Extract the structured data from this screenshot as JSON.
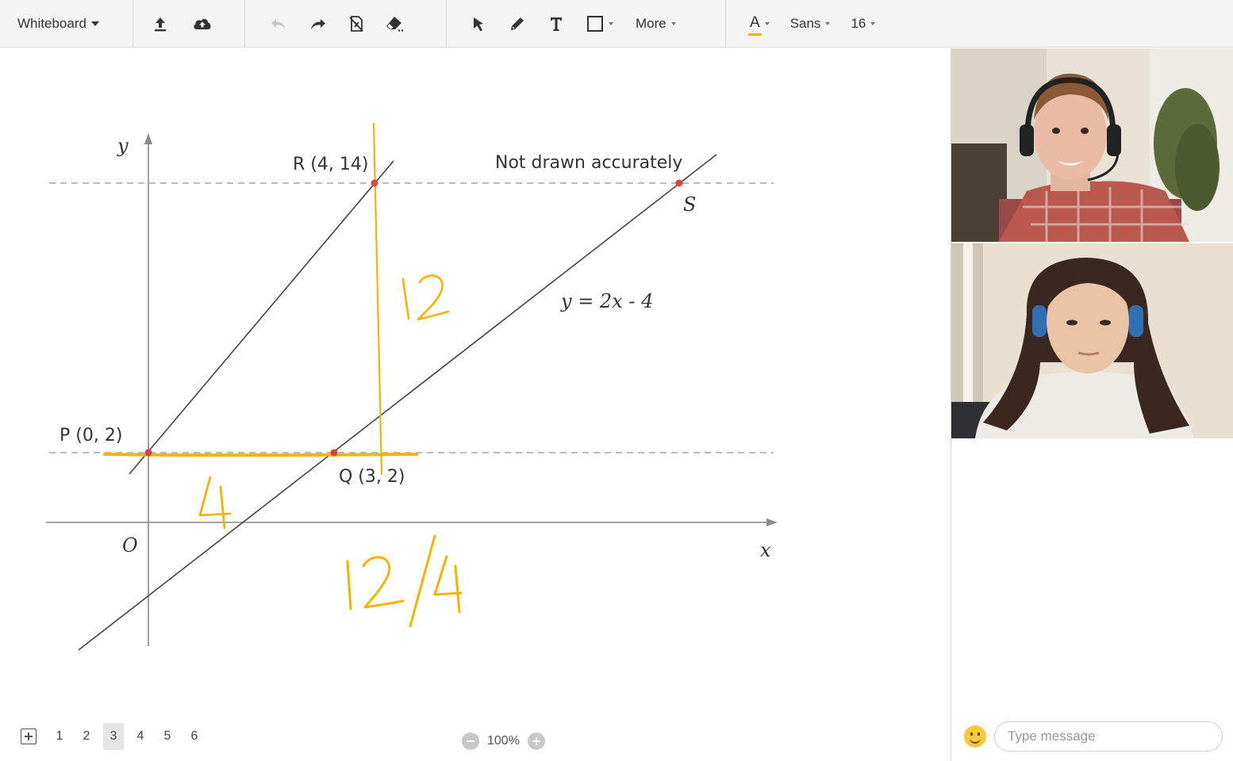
{
  "toolbar": {
    "board_menu_label": "Whiteboard",
    "icons": [
      "upload-icon",
      "cloud-icon",
      "undo-icon",
      "redo-icon",
      "clear-page-icon",
      "eraser-icon",
      "select-icon",
      "pen-icon",
      "text-icon",
      "shape-icon"
    ],
    "more_label": "More",
    "text_color_label": "A",
    "font_label": "Sans",
    "font_size_label": "16",
    "accent_color": "#f5b400"
  },
  "board": {
    "axis_y_label": "y",
    "axis_x_label": "x",
    "origin_label": "O",
    "point_r_label": "R (4, 14)",
    "point_p_label": "P (0, 2)",
    "point_q_label": "Q (3, 2)",
    "point_s_label": "S",
    "note_label": "Not drawn accurately",
    "equation_label": "y = 2x - 4",
    "handwriting": {
      "vertical_length": "12",
      "horizontal_length": "4",
      "gradient": "12/4"
    },
    "ink_color": "#f5b400",
    "point_color": "#d9473a"
  },
  "pages": {
    "items": [
      "1",
      "2",
      "3",
      "4",
      "5",
      "6"
    ],
    "active": "3"
  },
  "zoom": {
    "level": "100%"
  },
  "chat": {
    "placeholder": "Type message"
  }
}
